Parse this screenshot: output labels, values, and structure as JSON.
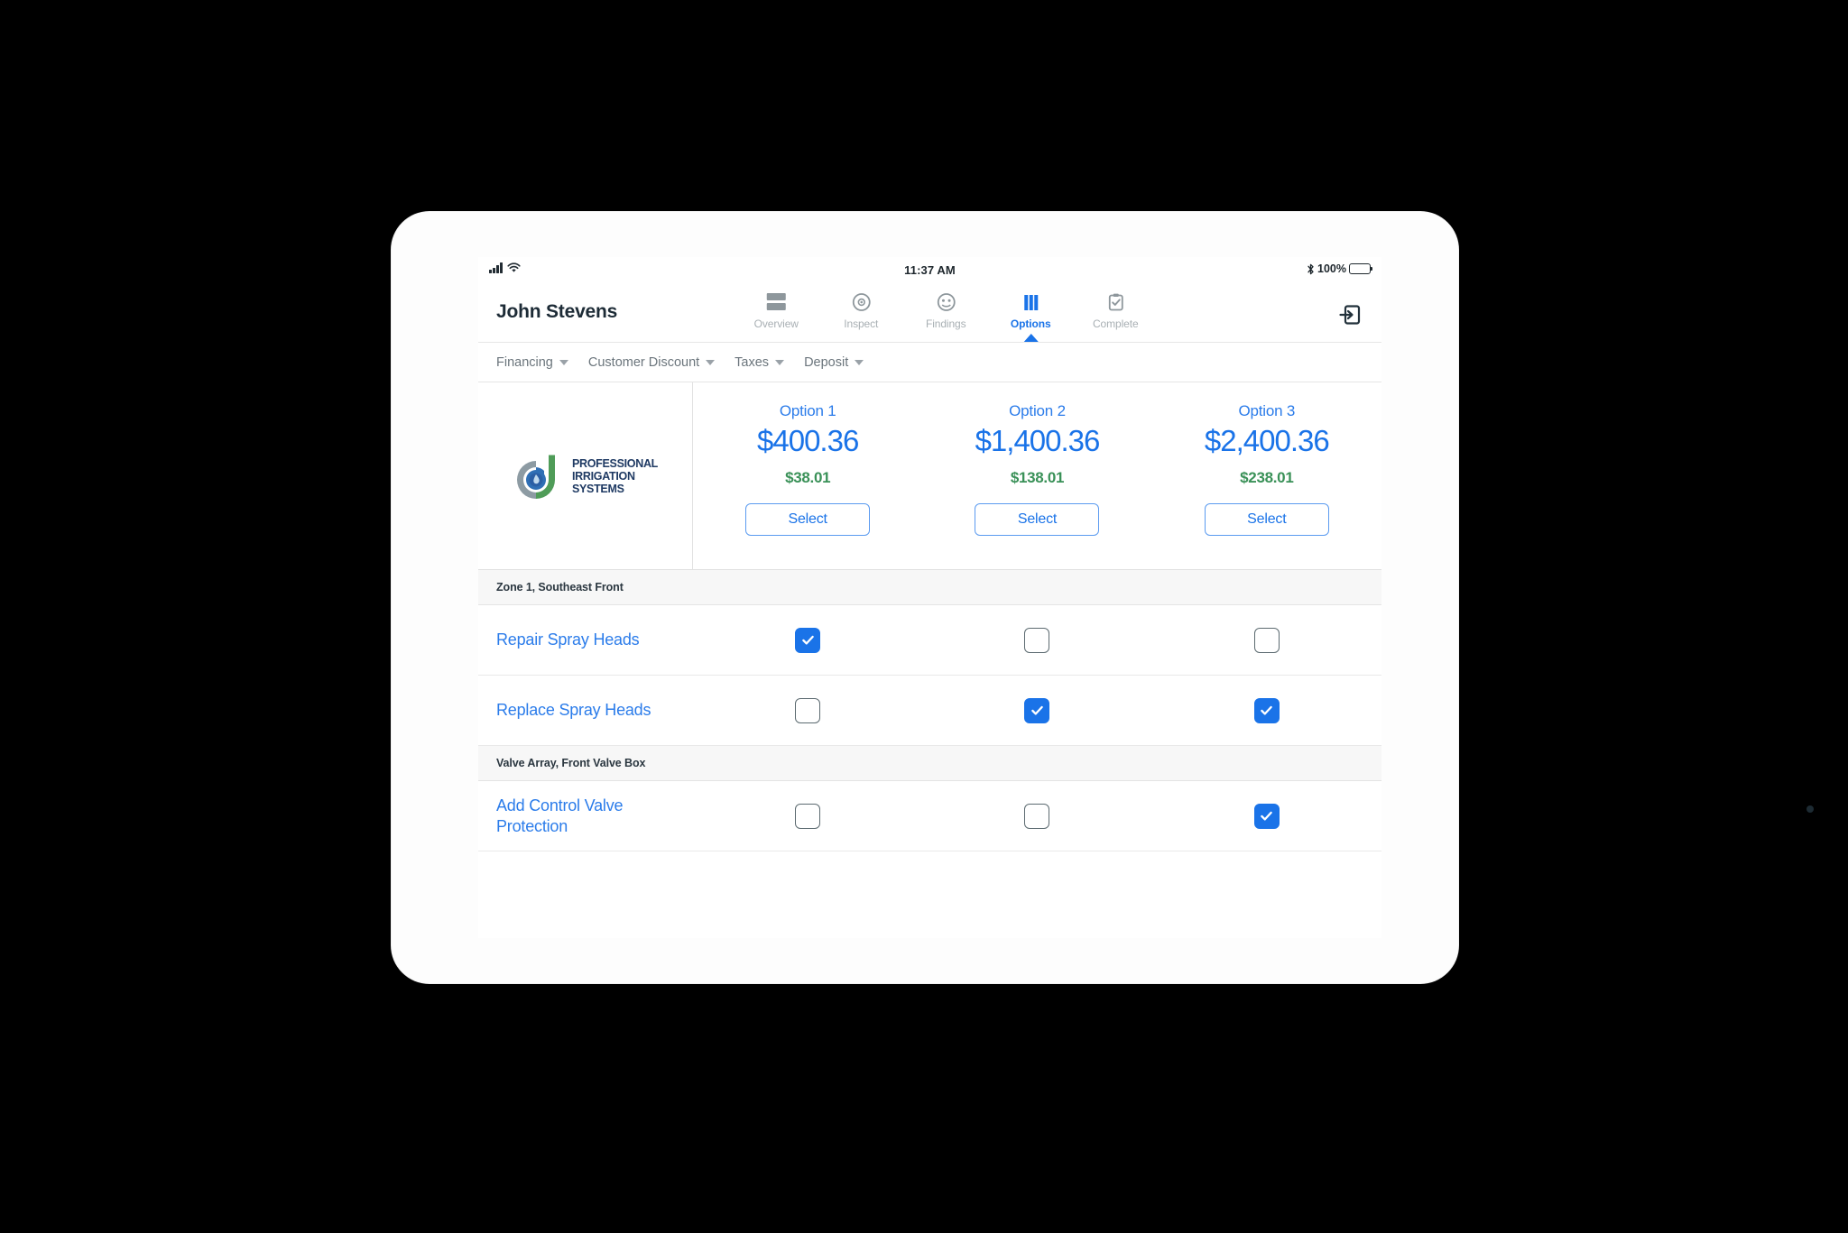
{
  "status_bar": {
    "time": "11:37 AM",
    "battery_percent": "100%",
    "signal_icon": "cellular-signal-icon",
    "wifi_icon": "wifi-icon",
    "bluetooth_icon": "bluetooth-icon",
    "battery_icon": "battery-icon"
  },
  "header": {
    "customer_name": "John Stevens",
    "logout_icon": "logout-icon",
    "tabs": [
      {
        "label": "Overview",
        "icon": "overview-icon",
        "active": false
      },
      {
        "label": "Inspect",
        "icon": "inspect-target-icon",
        "active": false
      },
      {
        "label": "Findings",
        "icon": "findings-face-icon",
        "active": false
      },
      {
        "label": "Options",
        "icon": "options-columns-icon",
        "active": true
      },
      {
        "label": "Complete",
        "icon": "complete-clipboard-check-icon",
        "active": false
      }
    ]
  },
  "filter_bar": {
    "items": [
      {
        "label": "Financing"
      },
      {
        "label": "Customer Discount"
      },
      {
        "label": "Taxes"
      },
      {
        "label": "Deposit"
      }
    ]
  },
  "company": {
    "logo_icon": "professional-irrigation-systems-logo",
    "name_line1": "PROFESSIONAL",
    "name_line2": "IRRIGATION",
    "name_line3": "SYSTEMS"
  },
  "options": [
    {
      "name": "Option 1",
      "price": "$400.36",
      "monthly": "$38.01",
      "select_label": "Select"
    },
    {
      "name": "Option 2",
      "price": "$1,400.36",
      "monthly": "$138.01",
      "select_label": "Select"
    },
    {
      "name": "Option 3",
      "price": "$2,400.36",
      "monthly": "$238.01",
      "select_label": "Select"
    }
  ],
  "sections": [
    {
      "title": "Zone 1, Southeast Front",
      "rows": [
        {
          "label": "Repair Spray Heads",
          "checks": [
            true,
            false,
            false
          ]
        },
        {
          "label": "Replace Spray Heads",
          "checks": [
            false,
            true,
            true
          ]
        }
      ]
    },
    {
      "title": "Valve Array, Front Valve Box",
      "rows": [
        {
          "label": "Add Control Valve Protection",
          "checks": [
            false,
            false,
            true
          ]
        }
      ]
    }
  ],
  "colors": {
    "accent_blue": "#1a73e8",
    "link_blue": "#2b7cea",
    "money_green": "#3a9158",
    "muted_gray": "#a9b0b4",
    "section_bg": "#f7f7f7",
    "background": "#000000"
  }
}
